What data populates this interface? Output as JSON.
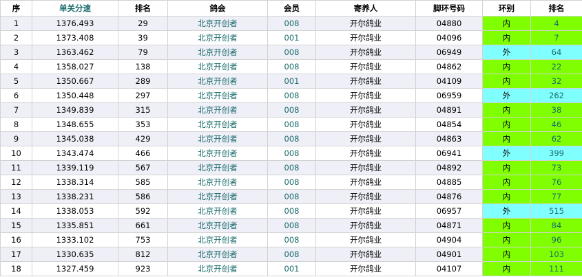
{
  "colors": {
    "accent_text": "#1a6b6b",
    "row_alt": "#efeff8",
    "ring_inner": "#80ff00",
    "ring_outer": "#80ffff"
  },
  "headers": [
    "序",
    "单关分速",
    "排名",
    "鸽会",
    "会员",
    "寄养人",
    "脚环号码",
    "环别",
    "排名"
  ],
  "rows": [
    [
      "1",
      "1376.493",
      "29",
      "北京开创者",
      "008",
      "开尔鸽业",
      "04880",
      "内",
      "4"
    ],
    [
      "2",
      "1373.408",
      "39",
      "北京开创者",
      "001",
      "开尔鸽业",
      "04096",
      "内",
      "7"
    ],
    [
      "3",
      "1363.462",
      "79",
      "北京开创者",
      "008",
      "开尔鸽业",
      "06949",
      "外",
      "64"
    ],
    [
      "4",
      "1358.027",
      "138",
      "北京开创者",
      "008",
      "开尔鸽业",
      "04862",
      "内",
      "22"
    ],
    [
      "5",
      "1350.667",
      "289",
      "北京开创者",
      "001",
      "开尔鸽业",
      "04109",
      "内",
      "32"
    ],
    [
      "6",
      "1350.448",
      "297",
      "北京开创者",
      "008",
      "开尔鸽业",
      "06959",
      "外",
      "262"
    ],
    [
      "7",
      "1349.839",
      "315",
      "北京开创者",
      "008",
      "开尔鸽业",
      "04891",
      "内",
      "38"
    ],
    [
      "8",
      "1348.655",
      "353",
      "北京开创者",
      "008",
      "开尔鸽业",
      "04854",
      "内",
      "46"
    ],
    [
      "9",
      "1345.038",
      "429",
      "北京开创者",
      "008",
      "开尔鸽业",
      "04863",
      "内",
      "62"
    ],
    [
      "10",
      "1343.474",
      "466",
      "北京开创者",
      "008",
      "开尔鸽业",
      "06941",
      "外",
      "399"
    ],
    [
      "11",
      "1339.119",
      "567",
      "北京开创者",
      "008",
      "开尔鸽业",
      "04892",
      "内",
      "73"
    ],
    [
      "12",
      "1338.314",
      "585",
      "北京开创者",
      "008",
      "开尔鸽业",
      "04885",
      "内",
      "76"
    ],
    [
      "13",
      "1338.231",
      "586",
      "北京开创者",
      "008",
      "开尔鸽业",
      "04876",
      "内",
      "77"
    ],
    [
      "14",
      "1338.053",
      "592",
      "北京开创者",
      "008",
      "开尔鸽业",
      "06957",
      "外",
      "515"
    ],
    [
      "15",
      "1335.851",
      "661",
      "北京开创者",
      "008",
      "开尔鸽业",
      "04871",
      "内",
      "84"
    ],
    [
      "16",
      "1333.102",
      "753",
      "北京开创者",
      "008",
      "开尔鸽业",
      "04904",
      "内",
      "96"
    ],
    [
      "17",
      "1330.635",
      "812",
      "北京开创者",
      "008",
      "开尔鸽业",
      "04901",
      "内",
      "103"
    ],
    [
      "18",
      "1327.459",
      "923",
      "北京开创者",
      "001",
      "开尔鸽业",
      "04107",
      "内",
      "111"
    ]
  ]
}
